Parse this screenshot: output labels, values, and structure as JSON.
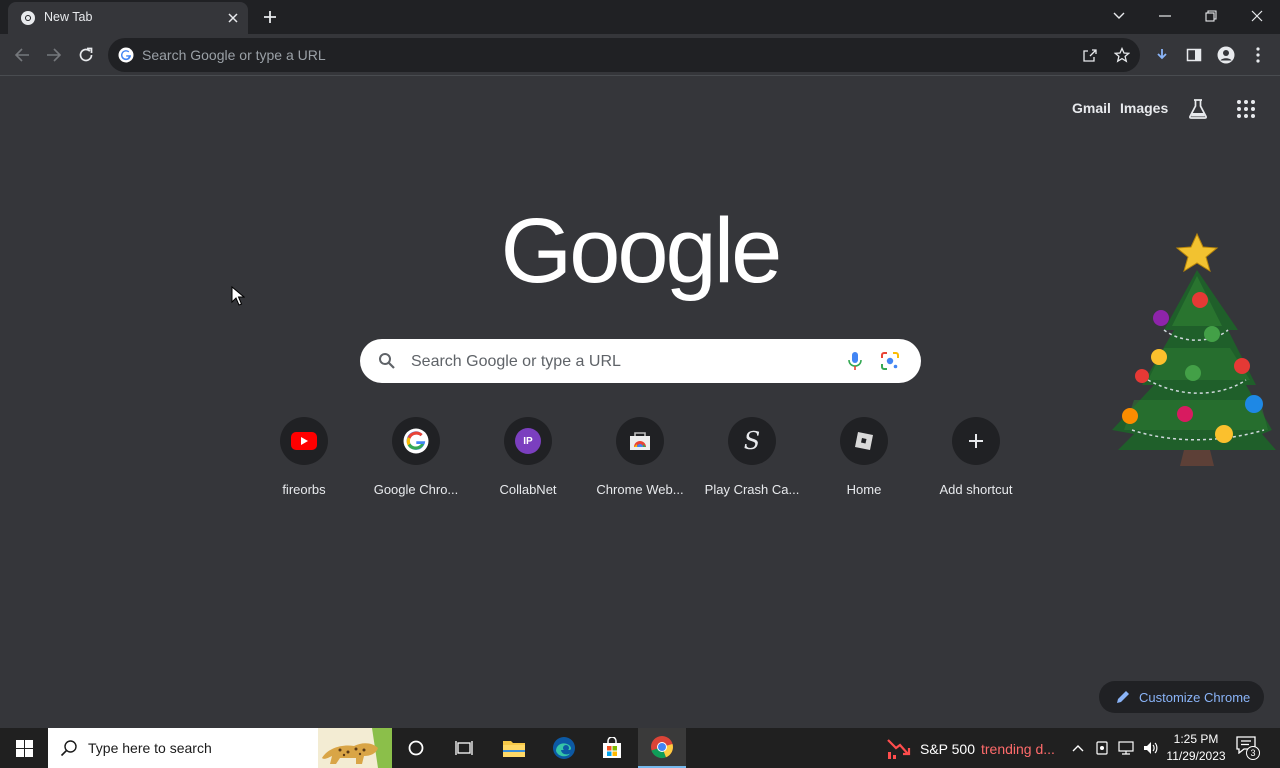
{
  "browser": {
    "tab": {
      "title": "New Tab"
    },
    "omnibox": {
      "placeholder": "Search Google or type a URL"
    }
  },
  "topbar": {
    "gmail_label": "Gmail",
    "images_label": "Images"
  },
  "logo": {
    "text": "Google"
  },
  "search": {
    "placeholder": "Search Google or type a URL"
  },
  "shortcuts": [
    {
      "label": "fireorbs",
      "icon": "youtube-icon"
    },
    {
      "label": "Google Chro...",
      "icon": "google-icon"
    },
    {
      "label": "CollabNet",
      "icon": "collabnet-icon",
      "badge": "IP"
    },
    {
      "label": "Chrome Web...",
      "icon": "chrome-web-store-icon"
    },
    {
      "label": "Play Crash Ca...",
      "icon": "crash-casino-icon",
      "badge": "S"
    },
    {
      "label": "Home",
      "icon": "roblox-icon"
    },
    {
      "label": "Add shortcut",
      "icon": "plus-icon"
    }
  ],
  "customize": {
    "label": "Customize Chrome"
  },
  "taskbar": {
    "search_placeholder": "Type here to search",
    "news": {
      "title": "S&P 500",
      "subtitle": "trending d..."
    },
    "clock": {
      "time": "1:25 PM",
      "date": "11/29/2023"
    },
    "notification_count": "3"
  },
  "colors": {
    "page_bg": "#35363a",
    "tabstrip_bg": "#202124",
    "accent_blue": "#8ab4f8",
    "taskbar_bg": "#202020",
    "news_red": "#ff6b6b"
  }
}
